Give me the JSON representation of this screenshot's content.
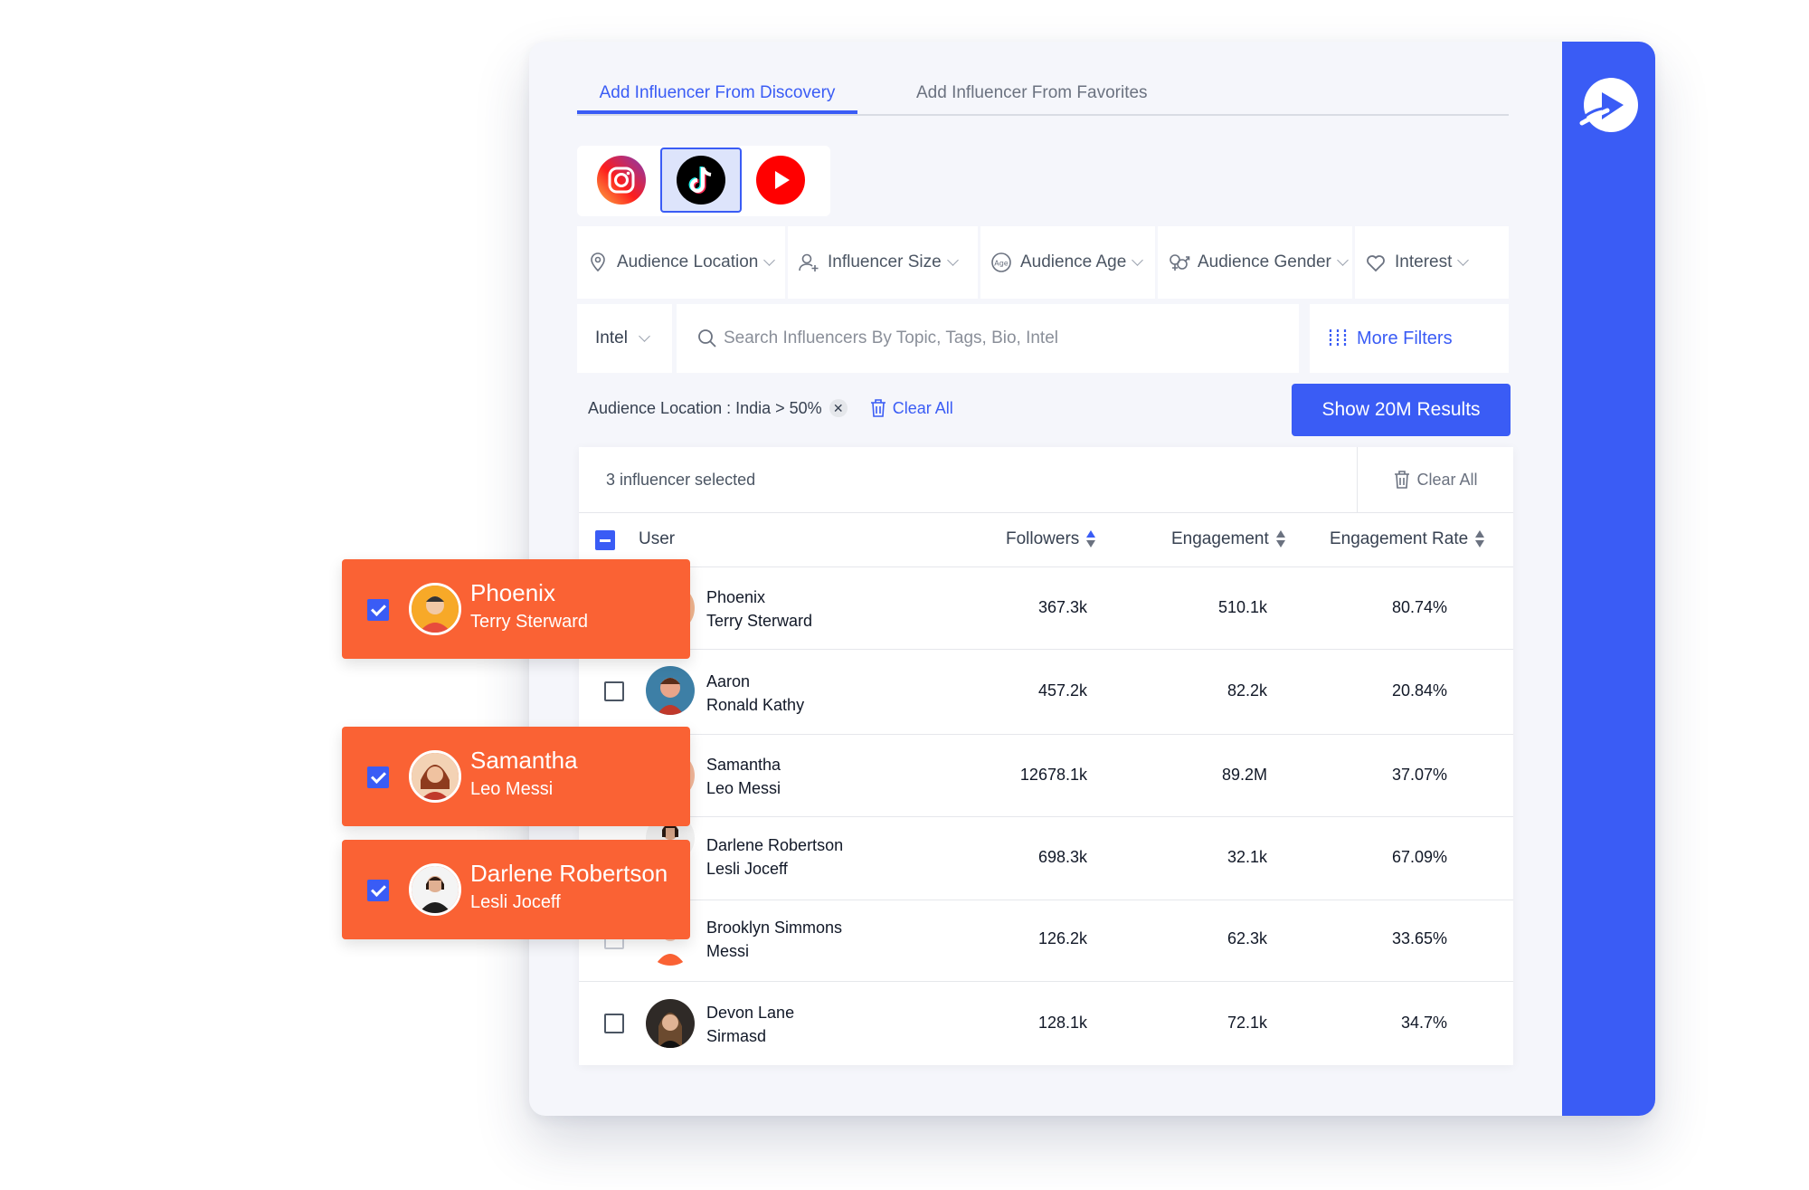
{
  "tabs": {
    "discovery": "Add Influencer From Discovery",
    "favorites": "Add Influencer From Favorites"
  },
  "platforms": [
    "instagram-icon",
    "tiktok-icon",
    "youtube-icon"
  ],
  "filters": {
    "audience_location": "Audience Location",
    "influencer_size": "Influencer Size",
    "audience_age": "Audience Age",
    "audience_gender": "Audience Gender",
    "interest": "Interest"
  },
  "search": {
    "scope": "Intel",
    "placeholder": "Search Influencers By Topic, Tags, Bio, Intel",
    "more_filters": "More Filters"
  },
  "active_filter": {
    "chip": "Audience Location : India > 50%",
    "clear_all": "Clear All"
  },
  "show_results": "Show 20M Results",
  "selection": {
    "text": "3 influencer selected",
    "clear_all": "Clear All"
  },
  "table": {
    "headers": {
      "user": "User",
      "followers": "Followers",
      "engagement": "Engagement",
      "engagement_rate": "Engagement Rate"
    },
    "rows": [
      {
        "first": "Phoenix",
        "last": "Terry Sterward",
        "followers": "367.3k",
        "engagement": "510.1k",
        "rate": "80.74%"
      },
      {
        "first": "Aaron",
        "last": "Ronald Kathy",
        "followers": "457.2k",
        "engagement": "82.2k",
        "rate": "20.84%"
      },
      {
        "first": "Samantha",
        "last": "Leo Messi",
        "followers": "12678.1k",
        "engagement": "89.2M",
        "rate": "37.07%"
      },
      {
        "first": "Darlene Robertson",
        "last": "Lesli Joceff",
        "followers": "698.3k",
        "engagement": "32.1k",
        "rate": "67.09%"
      },
      {
        "first": "Brooklyn Simmons",
        "last": "Messi",
        "followers": "126.2k",
        "engagement": "62.3k",
        "rate": "33.65%"
      },
      {
        "first": "Devon Lane",
        "last": "Sirmasd",
        "followers": "128.1k",
        "engagement": "72.1k",
        "rate": "34.7%"
      }
    ]
  },
  "selected_cards": [
    {
      "first": "Phoenix",
      "last": "Terry Sterward"
    },
    {
      "first": "Samantha",
      "last": "Leo Messi"
    },
    {
      "first": "Darlene Robertson",
      "last": "Lesli Joceff"
    }
  ],
  "colors": {
    "accent": "#3a5cf5",
    "card": "#fa6234"
  }
}
